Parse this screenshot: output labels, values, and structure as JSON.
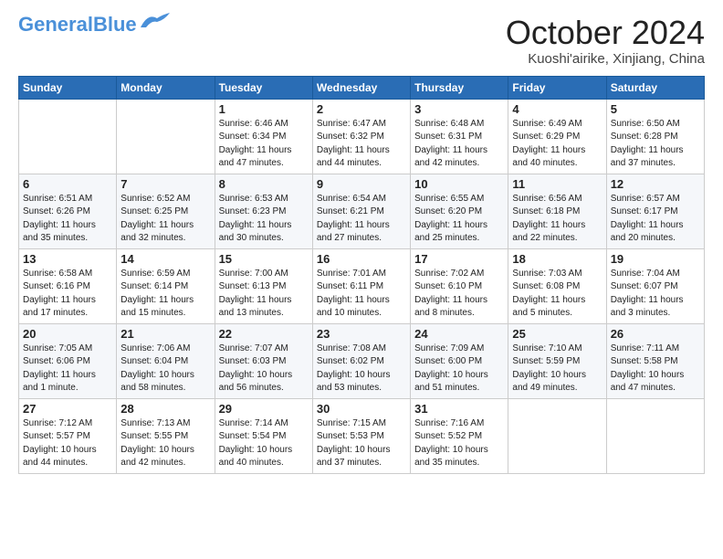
{
  "header": {
    "logo_line1": "General",
    "logo_line2": "Blue",
    "month_title": "October 2024",
    "location": "Kuoshi'airike, Xinjiang, China"
  },
  "weekdays": [
    "Sunday",
    "Monday",
    "Tuesday",
    "Wednesday",
    "Thursday",
    "Friday",
    "Saturday"
  ],
  "weeks": [
    [
      {
        "day": "",
        "sunrise": "",
        "sunset": "",
        "daylight": ""
      },
      {
        "day": "",
        "sunrise": "",
        "sunset": "",
        "daylight": ""
      },
      {
        "day": "1",
        "sunrise": "Sunrise: 6:46 AM",
        "sunset": "Sunset: 6:34 PM",
        "daylight": "Daylight: 11 hours and 47 minutes."
      },
      {
        "day": "2",
        "sunrise": "Sunrise: 6:47 AM",
        "sunset": "Sunset: 6:32 PM",
        "daylight": "Daylight: 11 hours and 44 minutes."
      },
      {
        "day": "3",
        "sunrise": "Sunrise: 6:48 AM",
        "sunset": "Sunset: 6:31 PM",
        "daylight": "Daylight: 11 hours and 42 minutes."
      },
      {
        "day": "4",
        "sunrise": "Sunrise: 6:49 AM",
        "sunset": "Sunset: 6:29 PM",
        "daylight": "Daylight: 11 hours and 40 minutes."
      },
      {
        "day": "5",
        "sunrise": "Sunrise: 6:50 AM",
        "sunset": "Sunset: 6:28 PM",
        "daylight": "Daylight: 11 hours and 37 minutes."
      }
    ],
    [
      {
        "day": "6",
        "sunrise": "Sunrise: 6:51 AM",
        "sunset": "Sunset: 6:26 PM",
        "daylight": "Daylight: 11 hours and 35 minutes."
      },
      {
        "day": "7",
        "sunrise": "Sunrise: 6:52 AM",
        "sunset": "Sunset: 6:25 PM",
        "daylight": "Daylight: 11 hours and 32 minutes."
      },
      {
        "day": "8",
        "sunrise": "Sunrise: 6:53 AM",
        "sunset": "Sunset: 6:23 PM",
        "daylight": "Daylight: 11 hours and 30 minutes."
      },
      {
        "day": "9",
        "sunrise": "Sunrise: 6:54 AM",
        "sunset": "Sunset: 6:21 PM",
        "daylight": "Daylight: 11 hours and 27 minutes."
      },
      {
        "day": "10",
        "sunrise": "Sunrise: 6:55 AM",
        "sunset": "Sunset: 6:20 PM",
        "daylight": "Daylight: 11 hours and 25 minutes."
      },
      {
        "day": "11",
        "sunrise": "Sunrise: 6:56 AM",
        "sunset": "Sunset: 6:18 PM",
        "daylight": "Daylight: 11 hours and 22 minutes."
      },
      {
        "day": "12",
        "sunrise": "Sunrise: 6:57 AM",
        "sunset": "Sunset: 6:17 PM",
        "daylight": "Daylight: 11 hours and 20 minutes."
      }
    ],
    [
      {
        "day": "13",
        "sunrise": "Sunrise: 6:58 AM",
        "sunset": "Sunset: 6:16 PM",
        "daylight": "Daylight: 11 hours and 17 minutes."
      },
      {
        "day": "14",
        "sunrise": "Sunrise: 6:59 AM",
        "sunset": "Sunset: 6:14 PM",
        "daylight": "Daylight: 11 hours and 15 minutes."
      },
      {
        "day": "15",
        "sunrise": "Sunrise: 7:00 AM",
        "sunset": "Sunset: 6:13 PM",
        "daylight": "Daylight: 11 hours and 13 minutes."
      },
      {
        "day": "16",
        "sunrise": "Sunrise: 7:01 AM",
        "sunset": "Sunset: 6:11 PM",
        "daylight": "Daylight: 11 hours and 10 minutes."
      },
      {
        "day": "17",
        "sunrise": "Sunrise: 7:02 AM",
        "sunset": "Sunset: 6:10 PM",
        "daylight": "Daylight: 11 hours and 8 minutes."
      },
      {
        "day": "18",
        "sunrise": "Sunrise: 7:03 AM",
        "sunset": "Sunset: 6:08 PM",
        "daylight": "Daylight: 11 hours and 5 minutes."
      },
      {
        "day": "19",
        "sunrise": "Sunrise: 7:04 AM",
        "sunset": "Sunset: 6:07 PM",
        "daylight": "Daylight: 11 hours and 3 minutes."
      }
    ],
    [
      {
        "day": "20",
        "sunrise": "Sunrise: 7:05 AM",
        "sunset": "Sunset: 6:06 PM",
        "daylight": "Daylight: 11 hours and 1 minute."
      },
      {
        "day": "21",
        "sunrise": "Sunrise: 7:06 AM",
        "sunset": "Sunset: 6:04 PM",
        "daylight": "Daylight: 10 hours and 58 minutes."
      },
      {
        "day": "22",
        "sunrise": "Sunrise: 7:07 AM",
        "sunset": "Sunset: 6:03 PM",
        "daylight": "Daylight: 10 hours and 56 minutes."
      },
      {
        "day": "23",
        "sunrise": "Sunrise: 7:08 AM",
        "sunset": "Sunset: 6:02 PM",
        "daylight": "Daylight: 10 hours and 53 minutes."
      },
      {
        "day": "24",
        "sunrise": "Sunrise: 7:09 AM",
        "sunset": "Sunset: 6:00 PM",
        "daylight": "Daylight: 10 hours and 51 minutes."
      },
      {
        "day": "25",
        "sunrise": "Sunrise: 7:10 AM",
        "sunset": "Sunset: 5:59 PM",
        "daylight": "Daylight: 10 hours and 49 minutes."
      },
      {
        "day": "26",
        "sunrise": "Sunrise: 7:11 AM",
        "sunset": "Sunset: 5:58 PM",
        "daylight": "Daylight: 10 hours and 47 minutes."
      }
    ],
    [
      {
        "day": "27",
        "sunrise": "Sunrise: 7:12 AM",
        "sunset": "Sunset: 5:57 PM",
        "daylight": "Daylight: 10 hours and 44 minutes."
      },
      {
        "day": "28",
        "sunrise": "Sunrise: 7:13 AM",
        "sunset": "Sunset: 5:55 PM",
        "daylight": "Daylight: 10 hours and 42 minutes."
      },
      {
        "day": "29",
        "sunrise": "Sunrise: 7:14 AM",
        "sunset": "Sunset: 5:54 PM",
        "daylight": "Daylight: 10 hours and 40 minutes."
      },
      {
        "day": "30",
        "sunrise": "Sunrise: 7:15 AM",
        "sunset": "Sunset: 5:53 PM",
        "daylight": "Daylight: 10 hours and 37 minutes."
      },
      {
        "day": "31",
        "sunrise": "Sunrise: 7:16 AM",
        "sunset": "Sunset: 5:52 PM",
        "daylight": "Daylight: 10 hours and 35 minutes."
      },
      {
        "day": "",
        "sunrise": "",
        "sunset": "",
        "daylight": ""
      },
      {
        "day": "",
        "sunrise": "",
        "sunset": "",
        "daylight": ""
      }
    ]
  ]
}
